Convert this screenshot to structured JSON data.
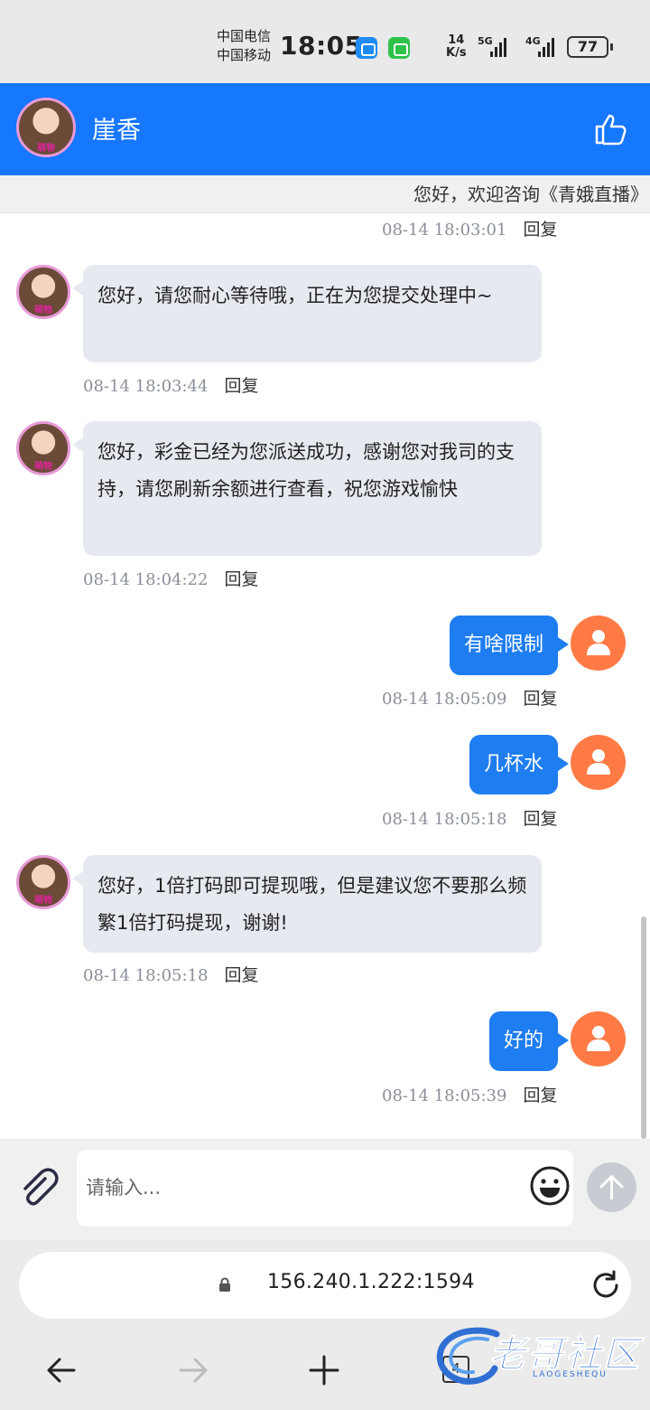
{
  "status_bar": {
    "carrier_1": "中国电信",
    "carrier_2": "中国移动",
    "time": "18:05",
    "speed_value": "14",
    "speed_unit": "K/s",
    "net_1": "5G",
    "net_2": "4G",
    "battery": "77"
  },
  "header": {
    "agent_name": "崖香",
    "avatar_badge": "萌物"
  },
  "notice": {
    "text": "您好，欢迎咨询《青娥直播》"
  },
  "messages": [
    {
      "side": "right",
      "time": "08-14 18:03:01",
      "reply": "回复"
    },
    {
      "side": "left",
      "text": "您好，请您耐心等待哦，正在为您提交处理中~",
      "time": "08-14 18:03:44",
      "reply": "回复"
    },
    {
      "side": "left",
      "text": "您好，彩金已经为您派送成功，感谢您对我司的支持，请您刷新余额进行查看，祝您游戏愉快",
      "time": "08-14 18:04:22",
      "reply": "回复"
    },
    {
      "side": "right",
      "text": "有啥限制",
      "time": "08-14 18:05:09",
      "reply": "回复"
    },
    {
      "side": "right",
      "text": "几杯水",
      "time": "08-14 18:05:18",
      "reply": "回复"
    },
    {
      "side": "left",
      "text": "您好，1倍打码即可提现哦，但是建议您不要那么频繁1倍打码提现，谢谢!",
      "time": "08-14 18:05:18",
      "reply": "回复"
    },
    {
      "side": "right",
      "text": "好的",
      "time": "08-14 18:05:39",
      "reply": "回复"
    }
  ],
  "input": {
    "placeholder": "请输入..."
  },
  "browser": {
    "url": "156.240.1.222:1594",
    "tab_count": "4"
  },
  "watermark": {
    "text": "老哥社区",
    "sub": "LAOGESHEQU"
  },
  "colors": {
    "header_blue": "#1677ff",
    "user_bubble": "#1e7df0",
    "agent_bubble": "#e6e9f0",
    "user_avatar": "#ff7a45"
  }
}
